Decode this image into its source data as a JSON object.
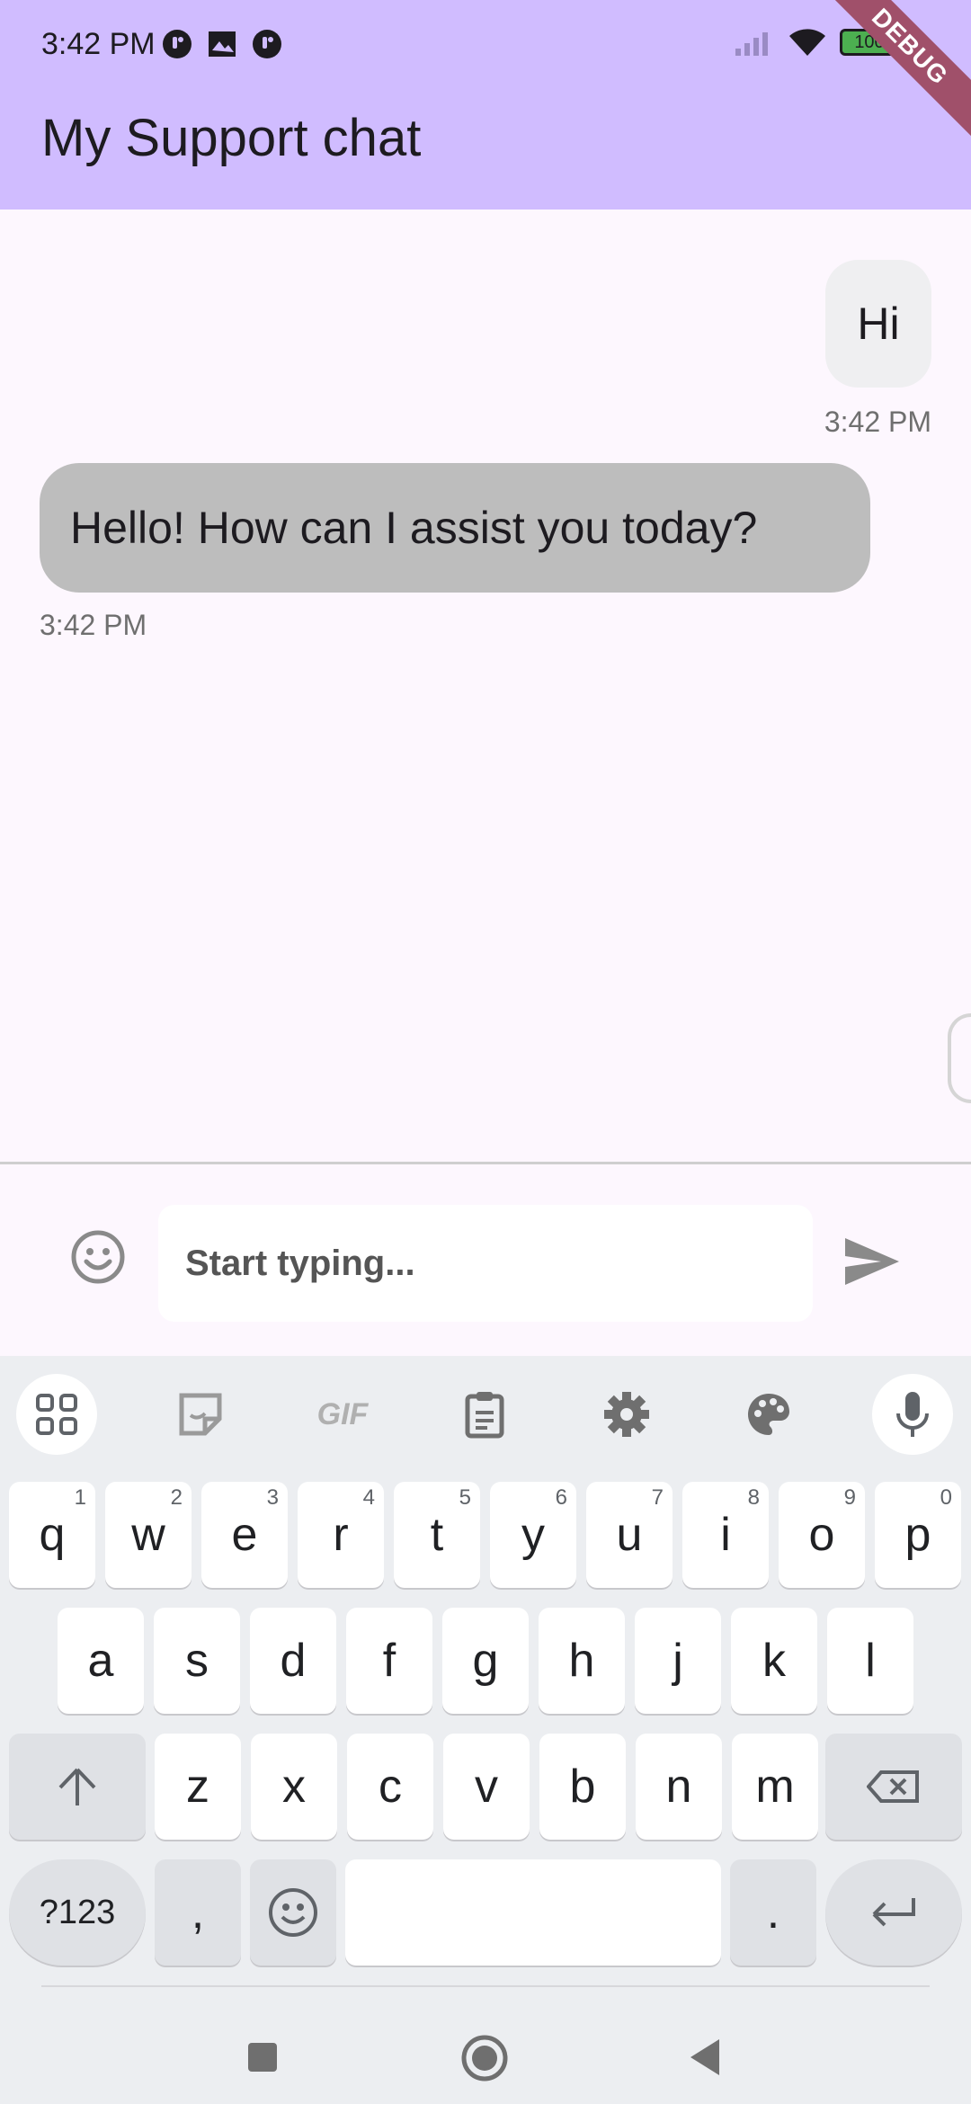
{
  "status_bar": {
    "time": "3:42 PM",
    "battery": "100",
    "debug_label": "DEBUG"
  },
  "header": {
    "title": "My Support chat",
    "background": "#d0bcff"
  },
  "messages": [
    {
      "sender": "user",
      "text": "Hi",
      "time": "3:42 PM"
    },
    {
      "sender": "bot",
      "text": "Hello! How can I assist you today?",
      "time": "3:42 PM"
    }
  ],
  "composer": {
    "placeholder": "Start typing..."
  },
  "keyboard": {
    "toolbar": [
      "apps-icon",
      "sticker-icon",
      "gif-icon",
      "clipboard-icon",
      "settings-icon",
      "palette-icon",
      "mic-icon"
    ],
    "gif_label": "GIF",
    "row1": [
      {
        "k": "q",
        "n": "1"
      },
      {
        "k": "w",
        "n": "2"
      },
      {
        "k": "e",
        "n": "3"
      },
      {
        "k": "r",
        "n": "4"
      },
      {
        "k": "t",
        "n": "5"
      },
      {
        "k": "y",
        "n": "6"
      },
      {
        "k": "u",
        "n": "7"
      },
      {
        "k": "i",
        "n": "8"
      },
      {
        "k": "o",
        "n": "9"
      },
      {
        "k": "p",
        "n": "0"
      }
    ],
    "row2": [
      "a",
      "s",
      "d",
      "f",
      "g",
      "h",
      "j",
      "k",
      "l"
    ],
    "row3": [
      "z",
      "x",
      "c",
      "v",
      "b",
      "n",
      "m"
    ],
    "symbols_label": "?123",
    "comma": ",",
    "period": "."
  }
}
